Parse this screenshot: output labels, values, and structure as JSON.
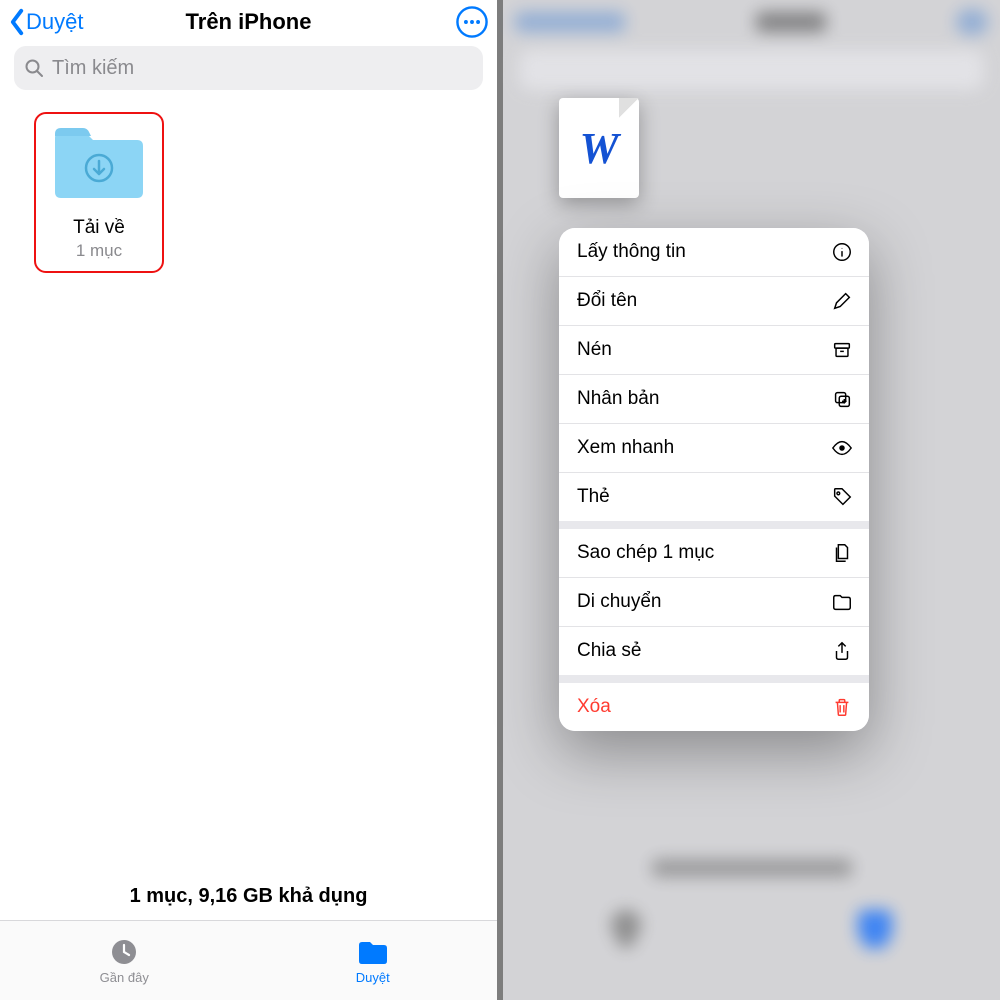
{
  "left": {
    "back_label": "Duyệt",
    "title": "Trên iPhone",
    "search_placeholder": "Tìm kiếm",
    "folder": {
      "name": "Tải về",
      "subtitle": "1 mục"
    },
    "storage": "1 mục, 9,16 GB khả dụng",
    "tabs": {
      "recent": "Gần đây",
      "browse": "Duyệt"
    }
  },
  "right": {
    "doc_glyph": "W",
    "menu": {
      "group1": [
        {
          "label": "Lấy thông tin",
          "icon": "info"
        },
        {
          "label": "Đổi tên",
          "icon": "pencil"
        },
        {
          "label": "Nén",
          "icon": "archive"
        },
        {
          "label": "Nhân bản",
          "icon": "duplicate"
        },
        {
          "label": "Xem nhanh",
          "icon": "eye"
        },
        {
          "label": "Thẻ",
          "icon": "tag"
        }
      ],
      "group2": [
        {
          "label": "Sao chép 1 mục",
          "icon": "copydoc"
        },
        {
          "label": "Di chuyển",
          "icon": "folder"
        },
        {
          "label": "Chia sẻ",
          "icon": "share"
        }
      ],
      "delete": {
        "label": "Xóa",
        "icon": "trash"
      }
    }
  }
}
